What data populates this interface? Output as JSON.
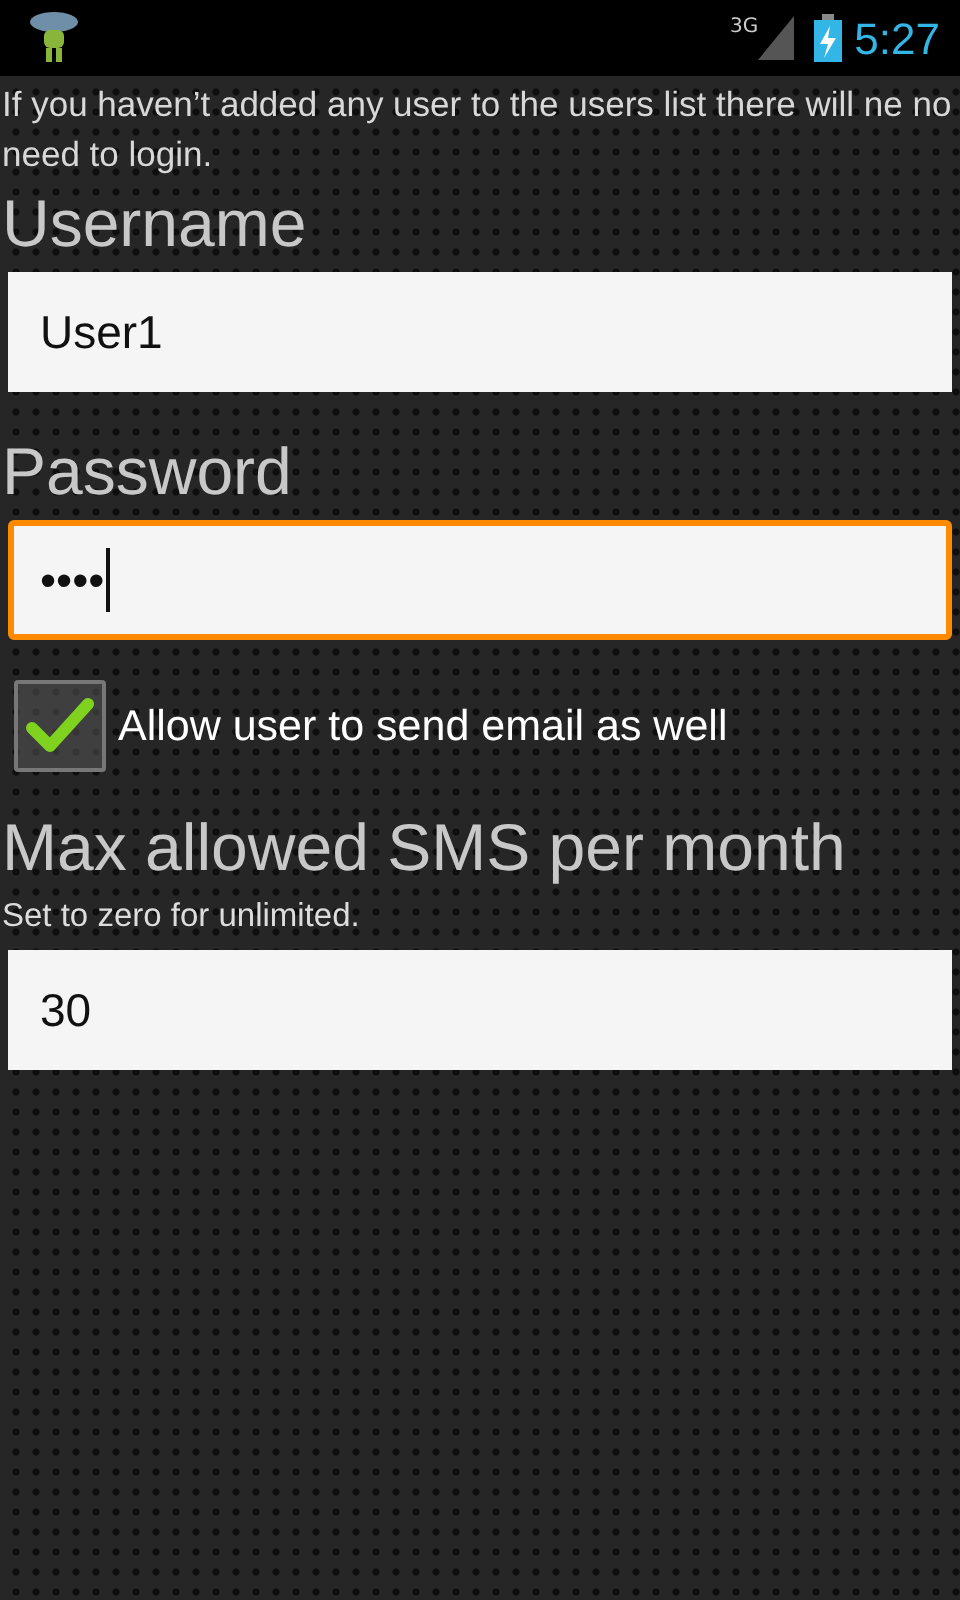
{
  "status_bar": {
    "network": "3G",
    "time": "5:27"
  },
  "intro": "If you haven’t added any user to the users list there will ne no need to login.",
  "fields": [
    {
      "kind": "text",
      "label": "Username",
      "value": "User1",
      "focused": false
    },
    {
      "kind": "text",
      "label": "Password",
      "value": "••••",
      "focused": true
    }
  ],
  "checkbox": {
    "label": "Allow user to send email as well",
    "checked": true
  },
  "sms": {
    "label": "Max allowed SMS per month",
    "hint": "Set to zero for unlimited.",
    "value": "30",
    "focused": false
  }
}
